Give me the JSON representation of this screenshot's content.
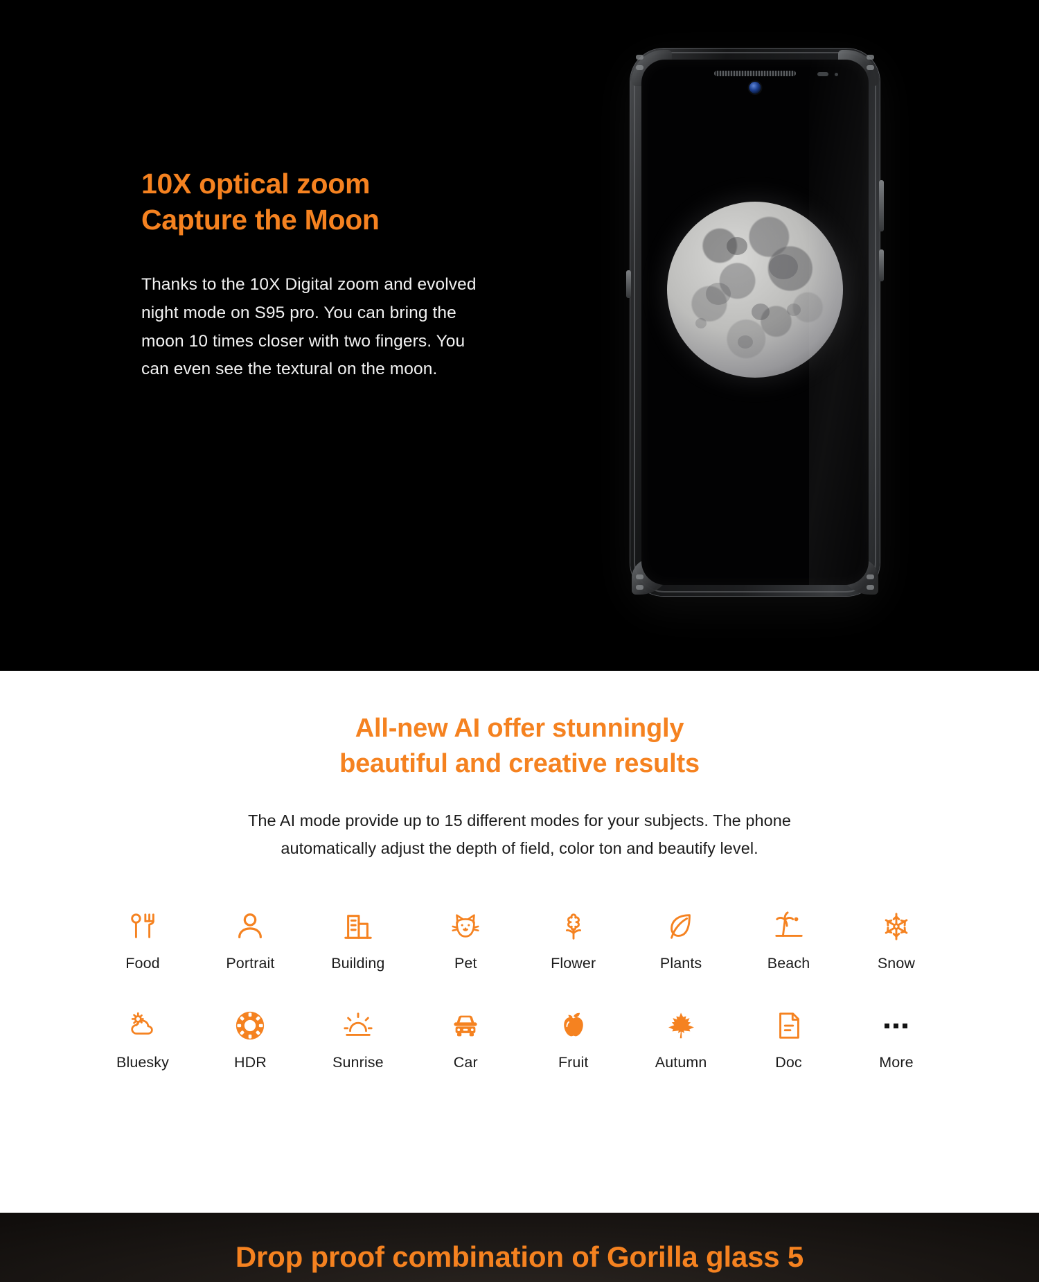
{
  "hero": {
    "title_line1": "10X optical zoom",
    "title_line2": "Capture the Moon",
    "body": "Thanks to the 10X Digital zoom and evolved night mode on S95 pro. You can bring the moon 10 times closer with two fingers. You can even see the textural on the moon.",
    "accent_color": "#F58220",
    "background_color": "#000000",
    "device_screen_subject": "moon"
  },
  "ai_section": {
    "title_line1": "All-new AI offer stunningly",
    "title_line2": "beautiful and creative results",
    "subtitle_line1": "The AI mode provide up to 15 different modes for your subjects. The phone",
    "subtitle_line2": "automatically adjust the depth of field, color ton and beautify level.",
    "accent_color": "#F58220",
    "background_color": "#FFFFFF",
    "modes_row_1": [
      {
        "label": "Food",
        "icon": "fork-spoon-icon"
      },
      {
        "label": "Portrait",
        "icon": "person-icon"
      },
      {
        "label": "Building",
        "icon": "building-icon"
      },
      {
        "label": "Pet",
        "icon": "cat-face-icon"
      },
      {
        "label": "Flower",
        "icon": "flower-icon"
      },
      {
        "label": "Plants",
        "icon": "leaf-icon"
      },
      {
        "label": "Beach",
        "icon": "palm-tree-icon"
      },
      {
        "label": "Snow",
        "icon": "snowflake-icon"
      }
    ],
    "modes_row_2": [
      {
        "label": "Bluesky",
        "icon": "sun-behind-cloud-icon"
      },
      {
        "label": "HDR",
        "icon": "aperture-icon"
      },
      {
        "label": "Sunrise",
        "icon": "sunrise-icon"
      },
      {
        "label": "Car",
        "icon": "car-front-icon"
      },
      {
        "label": "Fruit",
        "icon": "apple-icon"
      },
      {
        "label": "Autumn",
        "icon": "maple-leaf-icon"
      },
      {
        "label": "Doc",
        "icon": "document-icon"
      },
      {
        "label": "More",
        "icon": "ellipsis-icon"
      }
    ]
  },
  "drop_section": {
    "title": "Drop proof combination of Gorilla glass 5",
    "accent_color": "#F58220"
  }
}
